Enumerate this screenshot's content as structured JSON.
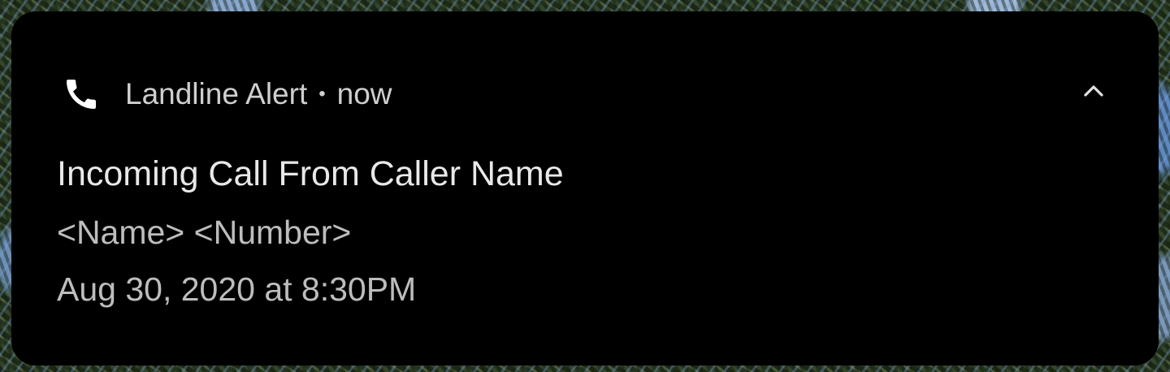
{
  "notification": {
    "app_icon": "phone-icon",
    "app_name": "Landline Alert",
    "separator": "•",
    "timestamp": "now",
    "expand_icon": "chevron-up-icon",
    "title": "Incoming Call From Caller Name",
    "body_lines": [
      "<Name> <Number>",
      "Aug 30, 2020 at 8:30PM"
    ]
  },
  "colors": {
    "card_background": "#000000",
    "primary_text": "#e8e8e8",
    "secondary_text": "#bdbdbd"
  }
}
